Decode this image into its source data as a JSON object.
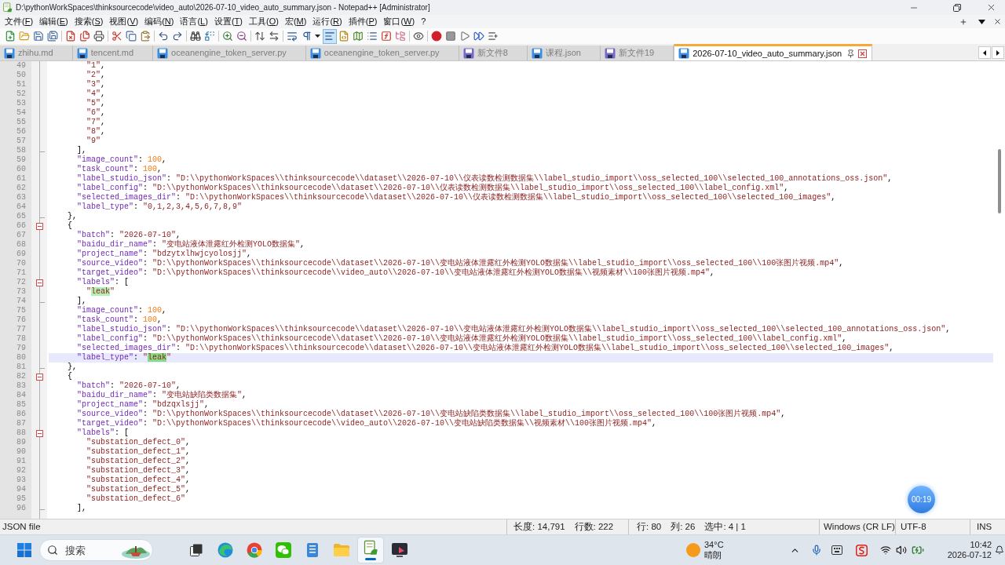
{
  "title_bar": {
    "title": "D:\\pythonWorkSpaces\\thinksourcecode\\video_auto\\2026-07-10_video_auto_summary.json - Notepad++ [Administrator]"
  },
  "menu": [
    "文件(F)",
    "编辑(E)",
    "搜索(S)",
    "视图(V)",
    "编码(N)",
    "语言(L)",
    "设置(T)",
    "工具(O)",
    "宏(M)",
    "运行(R)",
    "插件(P)",
    "窗口(W)",
    "?"
  ],
  "toolbar": [
    {
      "pressed": false
    },
    {
      "pressed": false
    },
    {
      "pressed": false
    },
    {
      "pressed": false
    },
    {
      "pressed": false
    },
    {
      "pressed": false
    },
    {
      "pressed": false
    },
    {
      "pressed": false
    },
    {
      "pressed": false
    },
    {
      "pressed": false
    },
    {
      "pressed": false
    },
    {
      "pressed": false
    },
    {
      "pressed": false
    },
    {
      "pressed": false
    },
    {
      "pressed": false
    },
    {
      "pressed": false
    },
    {
      "pressed": false
    },
    {
      "pressed": false
    },
    {
      "pressed": false
    },
    {
      "pressed": false
    },
    {
      "pressed": true
    },
    {
      "pressed": false
    },
    {
      "pressed": false
    },
    {
      "pressed": false
    },
    {
      "pressed": false
    },
    {
      "pressed": false
    },
    {
      "pressed": false
    },
    {
      "pressed": false
    },
    {
      "pressed": false
    },
    {
      "pressed": false
    },
    {
      "pressed": false
    },
    {
      "pressed": false
    }
  ],
  "tabs": [
    {
      "label": "zhihu.md",
      "selected": false,
      "color": "#3b8ee0"
    },
    {
      "label": "tencent.md",
      "selected": false,
      "color": "#3b8ee0"
    },
    {
      "label": "oceanengine_token_server.py",
      "selected": false,
      "color": "#3b8ee0"
    },
    {
      "label": "oceanengine_token_server.py",
      "selected": false,
      "color": "#3b8ee0"
    },
    {
      "label": "新文件8",
      "selected": false,
      "color": "#7a68c8"
    },
    {
      "label": "课程.json",
      "selected": false,
      "color": "#3b8ee0"
    },
    {
      "label": "新文件19",
      "selected": false,
      "color": "#7a68c8"
    },
    {
      "label": "2026-07-10_video_auto_summary.json",
      "selected": true,
      "color": "#3b8ee0"
    }
  ],
  "editor": {
    "lines": [
      {
        "number": "49",
        "text": "        \"1\",",
        "fold_start": false,
        "fold_end": false,
        "current": false
      },
      {
        "number": "50",
        "text": "        \"2\",",
        "fold_start": false,
        "fold_end": false,
        "current": false
      },
      {
        "number": "51",
        "text": "        \"3\",",
        "fold_start": false,
        "fold_end": false,
        "current": false
      },
      {
        "number": "52",
        "text": "        \"4\",",
        "fold_start": false,
        "fold_end": false,
        "current": false
      },
      {
        "number": "53",
        "text": "        \"5\",",
        "fold_start": false,
        "fold_end": false,
        "current": false
      },
      {
        "number": "54",
        "text": "        \"6\",",
        "fold_start": false,
        "fold_end": false,
        "current": false
      },
      {
        "number": "55",
        "text": "        \"7\",",
        "fold_start": false,
        "fold_end": false,
        "current": false
      },
      {
        "number": "56",
        "text": "        \"8\",",
        "fold_start": false,
        "fold_end": false,
        "current": false
      },
      {
        "number": "57",
        "text": "        \"9\"",
        "fold_start": false,
        "fold_end": false,
        "current": false
      },
      {
        "number": "58",
        "text": "      ],",
        "fold_start": false,
        "fold_end": true,
        "current": false
      },
      {
        "number": "59",
        "text": "      \"image_count\": 100,",
        "fold_start": false,
        "fold_end": false,
        "current": false
      },
      {
        "number": "60",
        "text": "      \"task_count\": 100,",
        "fold_start": false,
        "fold_end": false,
        "current": false
      },
      {
        "number": "61",
        "text": "      \"label_studio_json\": \"D:\\\\pythonWorkSpaces\\\\thinksourcecode\\\\dataset\\\\2026-07-10\\\\仪表读数检测数据集\\\\label_studio_import\\\\oss_selected_100\\\\selected_100_annotations_oss.json\",",
        "fold_start": false,
        "fold_end": false,
        "current": false
      },
      {
        "number": "62",
        "text": "      \"label_config\": \"D:\\\\pythonWorkSpaces\\\\thinksourcecode\\\\dataset\\\\2026-07-10\\\\仪表读数检测数据集\\\\label_studio_import\\\\oss_selected_100\\\\label_config.xml\",",
        "fold_start": false,
        "fold_end": false,
        "current": false
      },
      {
        "number": "63",
        "text": "      \"selected_images_dir\": \"D:\\\\pythonWorkSpaces\\\\thinksourcecode\\\\dataset\\\\2026-07-10\\\\仪表读数检测数据集\\\\label_studio_import\\\\oss_selected_100\\\\selected_100_images\",",
        "fold_start": false,
        "fold_end": false,
        "current": false
      },
      {
        "number": "64",
        "text": "      \"label_type\": \"0,1,2,3,4,5,6,7,8,9\"",
        "fold_start": false,
        "fold_end": false,
        "current": false
      },
      {
        "number": "65",
        "text": "    },",
        "fold_start": false,
        "fold_end": true,
        "current": false
      },
      {
        "number": "66",
        "text": "    {",
        "fold_start": true,
        "fold_end": false,
        "current": false
      },
      {
        "number": "67",
        "text": "      \"batch\": \"2026-07-10\",",
        "fold_start": false,
        "fold_end": false,
        "current": false
      },
      {
        "number": "68",
        "text": "      \"baidu_dir_name\": \"变电站液体泄露红外检测YOLO数据集\",",
        "fold_start": false,
        "fold_end": false,
        "current": false
      },
      {
        "number": "69",
        "text": "      \"project_name\": \"bdzytxlhwjcyolosjj\",",
        "fold_start": false,
        "fold_end": false,
        "current": false
      },
      {
        "number": "70",
        "text": "      \"source_video\": \"D:\\\\pythonWorkSpaces\\\\thinksourcecode\\\\dataset\\\\2026-07-10\\\\变电站液体泄露红外检测YOLO数据集\\\\label_studio_import\\\\oss_selected_100\\\\100张图片视频.mp4\",",
        "fold_start": false,
        "fold_end": false,
        "current": false
      },
      {
        "number": "71",
        "text": "      \"target_video\": \"D:\\\\pythonWorkSpaces\\\\thinksourcecode\\\\video_auto\\\\2026-07-10\\\\变电站液体泄露红外检测YOLO数据集\\\\视频素材\\\\100张图片视频.mp4\",",
        "fold_start": false,
        "fold_end": false,
        "current": false
      },
      {
        "number": "72",
        "text": "      \"labels\": [",
        "fold_start": true,
        "fold_end": false,
        "current": false
      },
      {
        "number": "73",
        "segments": [
          {
            "text": "        \"",
            "highlighted": false,
            "selected": false
          },
          {
            "text": "leak",
            "highlighted": true,
            "selected": false
          },
          {
            "text": "\"",
            "highlighted": false,
            "selected": false
          }
        ],
        "fold_start": false,
        "fold_end": false,
        "current": false
      },
      {
        "number": "74",
        "text": "      ],",
        "fold_start": false,
        "fold_end": true,
        "current": false
      },
      {
        "number": "75",
        "text": "      \"image_count\": 100,",
        "fold_start": false,
        "fold_end": false,
        "current": false
      },
      {
        "number": "76",
        "text": "      \"task_count\": 100,",
        "fold_start": false,
        "fold_end": false,
        "current": false
      },
      {
        "number": "77",
        "text": "      \"label_studio_json\": \"D:\\\\pythonWorkSpaces\\\\thinksourcecode\\\\dataset\\\\2026-07-10\\\\变电站液体泄露红外检测YOLO数据集\\\\label_studio_import\\\\oss_selected_100\\\\selected_100_annotations_oss.json\",",
        "fold_start": false,
        "fold_end": false,
        "current": false
      },
      {
        "number": "78",
        "text": "      \"label_config\": \"D:\\\\pythonWorkSpaces\\\\thinksourcecode\\\\dataset\\\\2026-07-10\\\\变电站液体泄露红外检测YOLO数据集\\\\label_studio_import\\\\oss_selected_100\\\\label_config.xml\",",
        "fold_start": false,
        "fold_end": false,
        "current": false
      },
      {
        "number": "79",
        "text": "      \"selected_images_dir\": \"D:\\\\pythonWorkSpaces\\\\thinksourcecode\\\\dataset\\\\2026-07-10\\\\变电站液体泄露红外检测YOLO数据集\\\\label_studio_import\\\\oss_selected_100\\\\selected_100_images\",",
        "fold_start": false,
        "fold_end": false,
        "current": false
      },
      {
        "number": "80",
        "segments": [
          {
            "text": "      \"label_type\": \"",
            "highlighted": false,
            "selected": false
          },
          {
            "text": "leak",
            "highlighted": true,
            "selected": true
          },
          {
            "text": "\"",
            "highlighted": false,
            "selected": false
          }
        ],
        "fold_start": false,
        "fold_end": false,
        "current": true
      },
      {
        "number": "81",
        "text": "    },",
        "fold_start": false,
        "fold_end": true,
        "current": false
      },
      {
        "number": "82",
        "text": "    {",
        "fold_start": true,
        "fold_end": false,
        "current": false
      },
      {
        "number": "83",
        "text": "      \"batch\": \"2026-07-10\",",
        "fold_start": false,
        "fold_end": false,
        "current": false
      },
      {
        "number": "84",
        "text": "      \"baidu_dir_name\": \"变电站缺陷类数据集\",",
        "fold_start": false,
        "fold_end": false,
        "current": false
      },
      {
        "number": "85",
        "text": "      \"project_name\": \"bdzqxlsjj\",",
        "fold_start": false,
        "fold_end": false,
        "current": false
      },
      {
        "number": "86",
        "text": "      \"source_video\": \"D:\\\\pythonWorkSpaces\\\\thinksourcecode\\\\dataset\\\\2026-07-10\\\\变电站缺陷类数据集\\\\label_studio_import\\\\oss_selected_100\\\\100张图片视频.mp4\",",
        "fold_start": false,
        "fold_end": false,
        "current": false
      },
      {
        "number": "87",
        "text": "      \"target_video\": \"D:\\\\pythonWorkSpaces\\\\thinksourcecode\\\\video_auto\\\\2026-07-10\\\\变电站缺陷类数据集\\\\视频素材\\\\100张图片视频.mp4\",",
        "fold_start": false,
        "fold_end": false,
        "current": false
      },
      {
        "number": "88",
        "text": "      \"labels\": [",
        "fold_start": true,
        "fold_end": false,
        "current": false
      },
      {
        "number": "89",
        "text": "        \"substation_defect_0\",",
        "fold_start": false,
        "fold_end": false,
        "current": false
      },
      {
        "number": "90",
        "text": "        \"substation_defect_1\",",
        "fold_start": false,
        "fold_end": false,
        "current": false
      },
      {
        "number": "91",
        "text": "        \"substation_defect_2\",",
        "fold_start": false,
        "fold_end": false,
        "current": false
      },
      {
        "number": "92",
        "text": "        \"substation_defect_3\",",
        "fold_start": false,
        "fold_end": false,
        "current": false
      },
      {
        "number": "93",
        "text": "        \"substation_defect_4\",",
        "fold_start": false,
        "fold_end": false,
        "current": false
      },
      {
        "number": "94",
        "text": "        \"substation_defect_5\",",
        "fold_start": false,
        "fold_end": false,
        "current": false
      },
      {
        "number": "95",
        "text": "        \"substation_defect_6\"",
        "fold_start": false,
        "fold_end": false,
        "current": false
      },
      {
        "number": "96",
        "text": "      ],",
        "fold_start": false,
        "fold_end": true,
        "current": false
      }
    ]
  },
  "recording_timer": "00:19",
  "status_bar": {
    "file_type": "JSON file",
    "length": "长度: 14,791",
    "line_count": "行数: 222",
    "line": "行: 80",
    "column": "列: 26",
    "selection": "选中: 4 | 1",
    "eol": "Windows (CR LF)",
    "encoding": "UTF-8",
    "mode": "INS"
  },
  "taskbar": {
    "search": {
      "placeholder": "搜索"
    },
    "apps": [
      {
        "active": false
      },
      {
        "active": false
      },
      {
        "active": false
      },
      {
        "active": false
      },
      {
        "active": false
      },
      {
        "active": true
      },
      {
        "active": false
      }
    ],
    "weather": {
      "temperature": "34°C",
      "condition": "晴朗"
    },
    "clock": {
      "time": "10:42",
      "date": "2026-07-12"
    }
  }
}
